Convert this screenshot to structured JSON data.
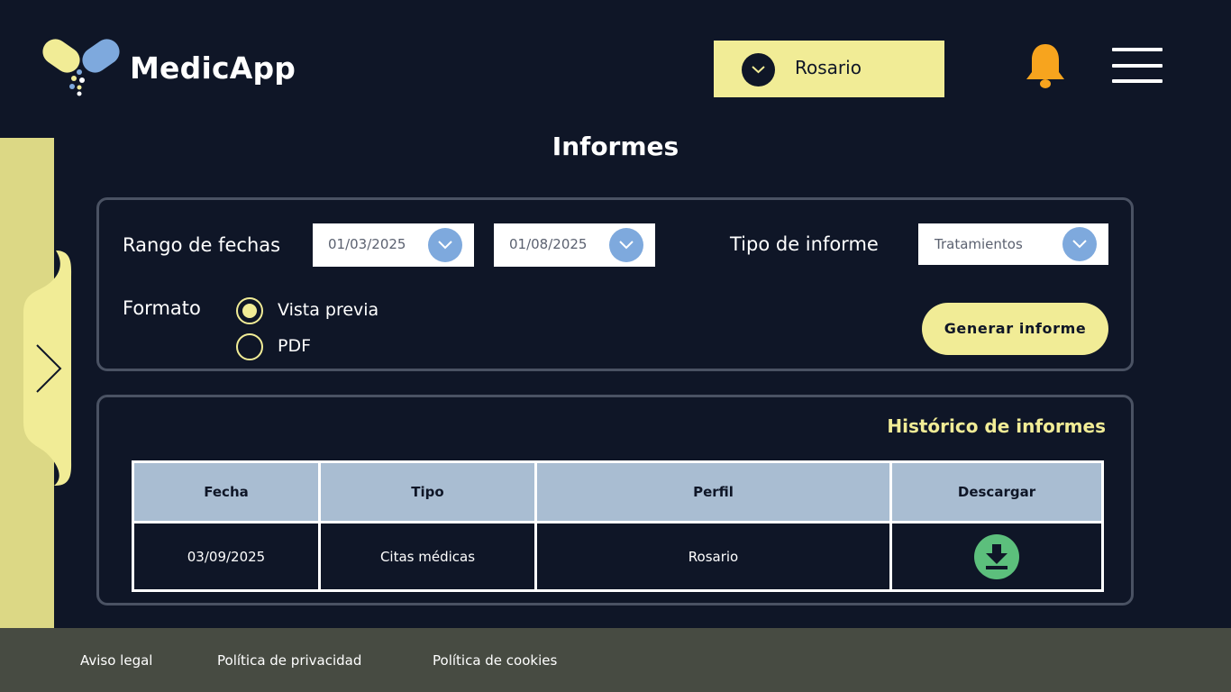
{
  "app": {
    "name": "MedicApp"
  },
  "header": {
    "profile_selected": "Rosario",
    "icons": {
      "notifications": "bell-icon",
      "menu": "hamburger-menu-icon",
      "profile_dropdown": "chevron-down-icon"
    }
  },
  "page": {
    "title": "Informes"
  },
  "filters": {
    "date_range_label": "Rango de fechas",
    "date_from": "01/03/2025",
    "date_to": "01/08/2025",
    "report_type_label": "Tipo de informe",
    "report_type_value": "Tratamientos",
    "format_label": "Formato",
    "format_options": [
      {
        "label": "Vista previa",
        "selected": true
      },
      {
        "label": "PDF",
        "selected": false
      }
    ],
    "generate_button": "Generar informe"
  },
  "history": {
    "title": "Histórico de informes",
    "columns": [
      "Fecha",
      "Tipo",
      "Perfil",
      "Descargar"
    ],
    "rows": [
      {
        "date": "03/09/2025",
        "type": "Citas médicas",
        "profile": "Rosario",
        "download_icon": "download-icon"
      }
    ]
  },
  "footer": {
    "links": [
      "Aviso legal",
      "Política de privacidad",
      "Política de cookies"
    ]
  },
  "colors": {
    "background": "#0f1627",
    "accent_yellow": "#f1ec96",
    "accent_blue": "#7ea9dd",
    "bell_orange": "#f7a41e",
    "download_green": "#5cbf7c",
    "table_header": "#a9bdd2",
    "footer_bg": "#474b42"
  }
}
